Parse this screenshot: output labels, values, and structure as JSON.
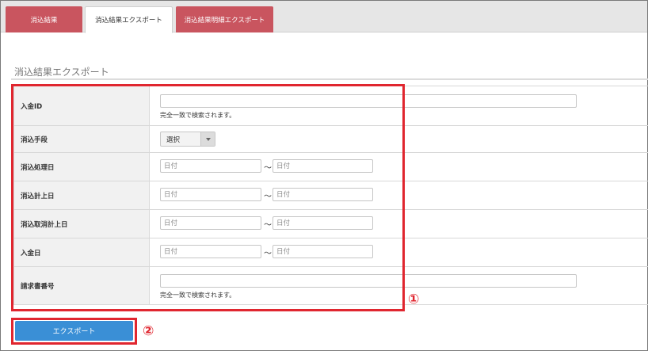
{
  "tabs": [
    {
      "label": "消込結果",
      "active": false
    },
    {
      "label": "消込結果エクスポート",
      "active": true
    },
    {
      "label": "消込結果明細エクスポート",
      "active": false
    }
  ],
  "section_title": "消込結果エクスポート",
  "form": {
    "deposit_id": {
      "label": "入金ID",
      "value": "",
      "hint": "完全一致で検索されます。"
    },
    "method": {
      "label": "消込手段",
      "selected": "選択"
    },
    "process_date": {
      "label": "消込処理日",
      "from_placeholder": "日付",
      "to_placeholder": "日付",
      "separator": "～"
    },
    "record_date": {
      "label": "消込計上日",
      "from_placeholder": "日付",
      "to_placeholder": "日付",
      "separator": "～"
    },
    "cancel_record_date": {
      "label": "消込取消計上日",
      "from_placeholder": "日付",
      "to_placeholder": "日付",
      "separator": "～"
    },
    "deposit_date": {
      "label": "入金日",
      "from_placeholder": "日付",
      "to_placeholder": "日付",
      "separator": "～"
    },
    "invoice_no": {
      "label": "請求書番号",
      "value": "",
      "hint": "完全一致で検索されます。"
    }
  },
  "export_button": {
    "label": "エクスポート"
  },
  "callouts": {
    "one": "①",
    "two": "②"
  },
  "colors": {
    "tab_red": "#c9555f",
    "button_blue": "#3a8fd6",
    "annotation_red": "#e0262f"
  }
}
